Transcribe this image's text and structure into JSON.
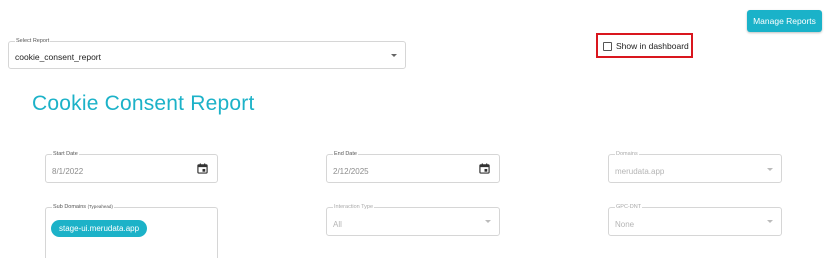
{
  "header": {
    "manage_reports_label": "Manage Reports"
  },
  "report_select": {
    "label": "Select Report",
    "value": "cookie_consent_report"
  },
  "dashboard_toggle": {
    "label": "Show in dashboard",
    "checked": false
  },
  "page": {
    "title": "Cookie Consent Report"
  },
  "filters": {
    "start_date": {
      "label": "Start Date",
      "value": "8/1/2022",
      "icon": "calendar-icon"
    },
    "end_date": {
      "label": "End Date",
      "value": "2/12/2025",
      "icon": "calendar-icon"
    },
    "domains": {
      "label": "Domains",
      "value": "merudata.app"
    },
    "sub_domains": {
      "label": "Sub Domains",
      "label_hint": "(Typeahead)",
      "chips": [
        "stage-ui.merudata.app"
      ]
    },
    "interaction_type": {
      "label": "Interaction Type",
      "value": "All"
    },
    "gpc_dnt": {
      "label": "GPC-DNT",
      "value": "None"
    }
  },
  "colors": {
    "accent": "#1ab2c9",
    "highlight_border": "#d9161e"
  }
}
